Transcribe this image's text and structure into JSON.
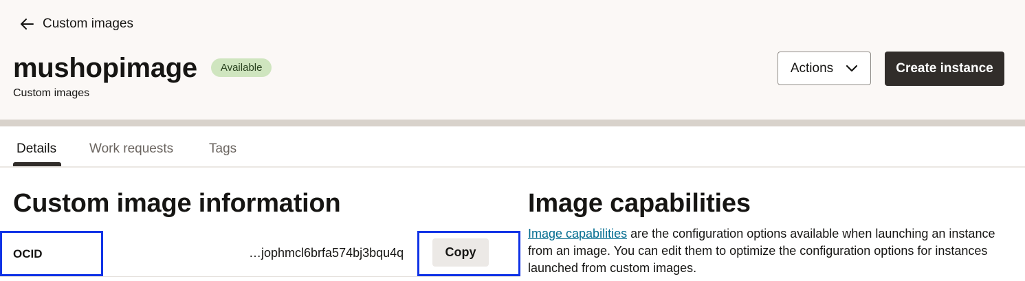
{
  "header": {
    "back_label": "Custom images",
    "title": "mushopimage",
    "status": "Available",
    "subtitle": "Custom images",
    "actions_label": "Actions",
    "create_label": "Create instance"
  },
  "tabs": [
    {
      "label": "Details",
      "active": true
    },
    {
      "label": "Work requests",
      "active": false
    },
    {
      "label": "Tags",
      "active": false
    }
  ],
  "info": {
    "heading": "Custom image information",
    "ocid_label": "OCID",
    "ocid_value": "…jophmcl6brfa574bj3bqu4q",
    "copy_label": "Copy"
  },
  "capabilities": {
    "heading": "Image capabilities",
    "link_text": "Image capabilities",
    "description": " are the configuration options available when launching an instance from an image. You can edit them to optimize the configuration options for instances launched from custom images."
  },
  "colors": {
    "accent_dark": "#312d2a",
    "status_bg": "#cfe5bf",
    "highlight_border": "#1033e6",
    "link": "#006b8f"
  },
  "icons": {
    "back": "arrow-left-icon",
    "actions": "chevron-down-icon"
  }
}
